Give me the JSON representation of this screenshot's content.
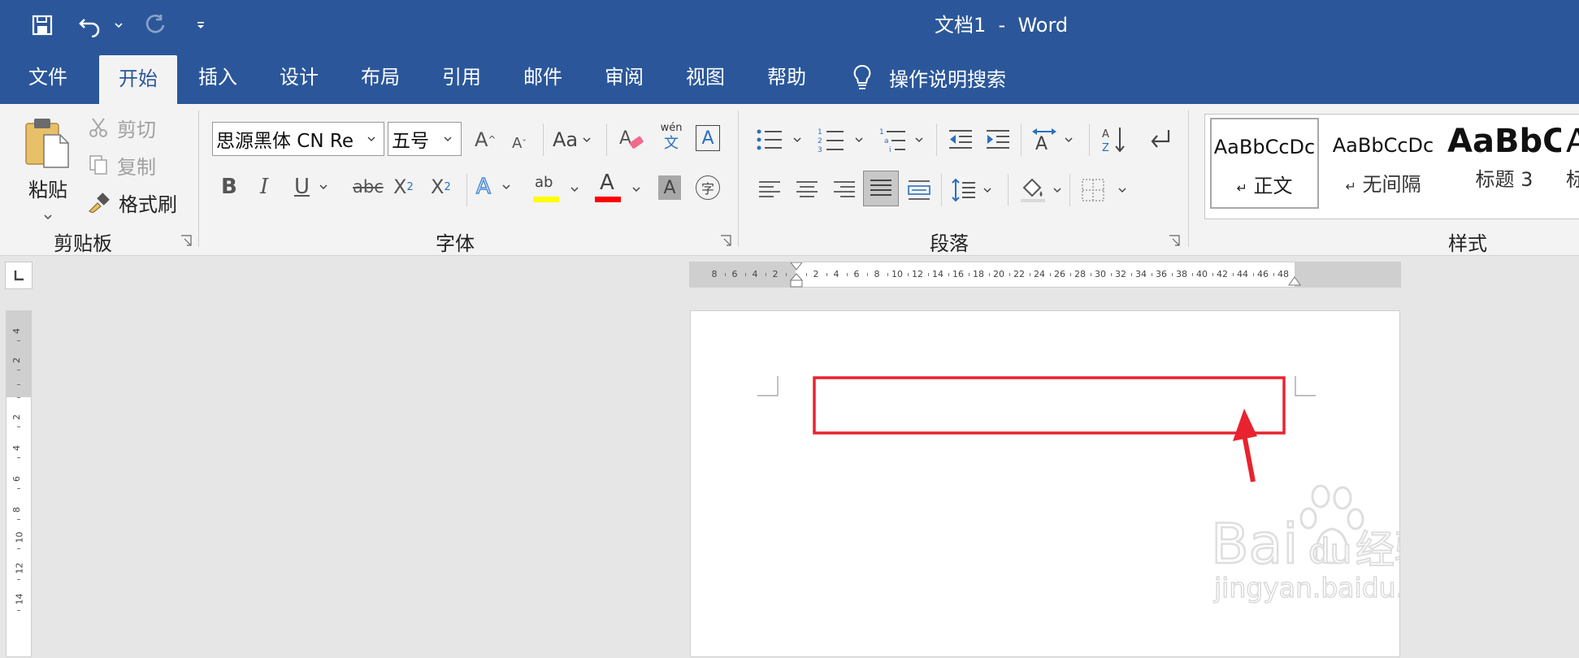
{
  "window": {
    "title": "文档1  -  Word"
  },
  "tabs": [
    {
      "label": "文件",
      "active": false
    },
    {
      "label": "开始",
      "active": true
    },
    {
      "label": "插入",
      "active": false
    },
    {
      "label": "设计",
      "active": false
    },
    {
      "label": "布局",
      "active": false
    },
    {
      "label": "引用",
      "active": false
    },
    {
      "label": "邮件",
      "active": false
    },
    {
      "label": "审阅",
      "active": false
    },
    {
      "label": "视图",
      "active": false
    },
    {
      "label": "帮助",
      "active": false
    }
  ],
  "tell_me": {
    "label": "操作说明搜索",
    "icon": "lightbulb-icon"
  },
  "clipboard": {
    "group_label": "剪贴板",
    "paste_label": "粘贴",
    "cut_label": "剪切",
    "copy_label": "复制",
    "format_painter_label": "格式刷"
  },
  "font": {
    "group_label": "字体",
    "font_name": "思源黑体 CN Re",
    "font_size": "五号",
    "case_label": "Aa",
    "phonetic_top": "wén",
    "phonetic_bottom": "文",
    "border_char": "A",
    "bold": "B",
    "italic": "I",
    "underline": "U",
    "strike": "abc",
    "sub": "X",
    "sub_mark": "2",
    "sup": "X",
    "sup_mark": "2",
    "effect": "A",
    "highlight": "ab",
    "font_color": "A",
    "shading": "A",
    "enclose": "字",
    "grow": "A",
    "shrink": "A",
    "highlight_color": "#ffff00",
    "font_color_value": "#ff0000"
  },
  "paragraph": {
    "group_label": "段落"
  },
  "styles": {
    "group_label": "样式",
    "items": [
      {
        "preview": "AaBbCcDc",
        "name": "正文",
        "mark": "↵"
      },
      {
        "preview": "AaBbCcDc",
        "name": "无间隔",
        "mark": "↵"
      },
      {
        "preview": "AaBbC",
        "name": "标题 3",
        "mark": ""
      },
      {
        "preview": "A",
        "name": "标",
        "mark": ""
      }
    ]
  },
  "ruler": {
    "left_numbers": [
      "8",
      "6",
      "4",
      "2"
    ],
    "numbers": [
      "2",
      "4",
      "6",
      "8",
      "10",
      "12",
      "14",
      "16",
      "18",
      "20",
      "22",
      "24",
      "26",
      "28",
      "30",
      "32",
      "34",
      "36",
      "38",
      "40",
      "42",
      "44",
      "46",
      "48"
    ],
    "vertical_numbers": [
      "4",
      "2",
      "2",
      "4",
      "6",
      "8",
      "10",
      "12",
      "14"
    ]
  },
  "colors": {
    "accent": "#2b579a",
    "highlight_box": "#e8232f",
    "arrow": "#e8232f"
  },
  "watermark": {
    "brand": "Bai du 经验",
    "url": "jingyan.baidu.com"
  }
}
